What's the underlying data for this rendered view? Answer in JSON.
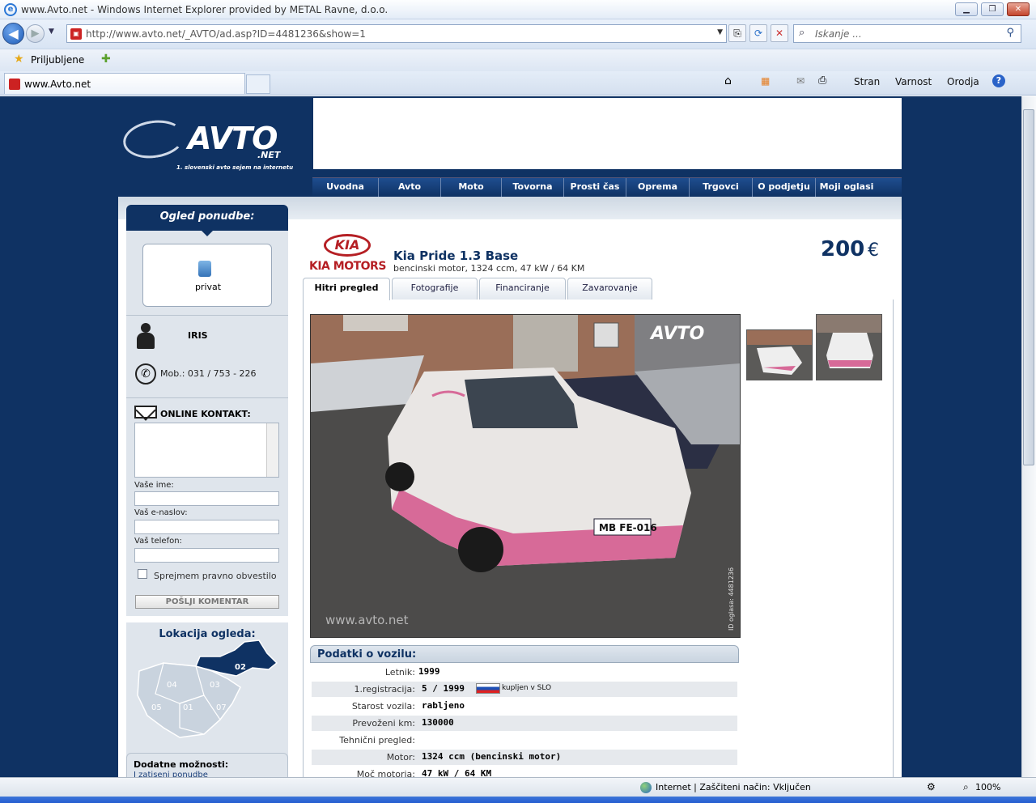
{
  "window": {
    "title": "www.Avto.net - Windows Internet Explorer provided by METAL Ravne, d.o.o."
  },
  "toolbar": {
    "url": "http://www.avto.net/_AVTO/ad.asp?ID=4481236&show=1",
    "search_placeholder": "Iskanje ...",
    "favorites_label": "Priljubljene",
    "tab_title": "www.Avto.net",
    "commands": [
      "Stran",
      "Varnost",
      "Orodja"
    ]
  },
  "site": {
    "logo_text": "AVTO",
    "logo_net": ".NET",
    "logo_tagline": "1. slovenski avto sejem na internetu",
    "nav": [
      "Uvodna",
      "Avto",
      "Moto",
      "Tovorna",
      "Prosti čas",
      "Oprema",
      "Trgovci",
      "O podjetju",
      "Moji oglasi"
    ]
  },
  "sidebar": {
    "heading": "Ogled ponudbe:",
    "seller_type": "privat",
    "seller_name": "IRIS",
    "phone": "Mob.: 031 / 753 - 226",
    "online_contact": "ONLINE KONTAKT:",
    "field_name": "Vaše ime:",
    "field_email": "Vaš e-naslov:",
    "field_phone": "Vaš telefon:",
    "terms": "Sprejmem pravno obvestilo",
    "send_button": "POŠLJI KOMENTAR",
    "location_title": "Lokacija ogleda:",
    "regions": [
      "02",
      "04",
      "03",
      "05",
      "01",
      "07"
    ],
    "active_region": "02",
    "extra_title": "Dodatne možnosti:",
    "extra_link": "I zatiseni ponudbe"
  },
  "listing": {
    "brand_logo": "KIA",
    "brand_motors": "KIA MOTORS",
    "title": "Kia Pride 1.3 Base",
    "subtitle": "bencinski motor,  1324 ccm, 47 kW / 64 KM",
    "price": "200",
    "currency": "€",
    "tabs": [
      "Hitri pregled",
      "Fotografije",
      "Financiranje",
      "Zavarovanje"
    ],
    "active_tab": "Hitri pregled",
    "photo_watermark": "www.avto.net",
    "photo_plate": "MB FE-016",
    "photo_id": "ID oglasa: 4481236"
  },
  "specs": {
    "heading": "Podatki o vozilu:",
    "rows": [
      {
        "label": "Letnik:",
        "value": "1999"
      },
      {
        "label": "1.registracija:",
        "value": " 5 / 1999"
      },
      {
        "label": "Starost vozila:",
        "value": "rabljeno"
      },
      {
        "label": "Prevoženi km:",
        "value": "130000"
      },
      {
        "label": "Tehnični pregled:",
        "value": ""
      },
      {
        "label": "Motor:",
        "value": "1324 ccm (bencinski motor)"
      },
      {
        "label": "Moč motorja:",
        "value": "47 kW  / 64 KM"
      }
    ],
    "flag_label": "kupljen v SLO"
  },
  "status": {
    "zone": "Internet | Zaščiteni način: Vključen",
    "zoom": "100%"
  }
}
